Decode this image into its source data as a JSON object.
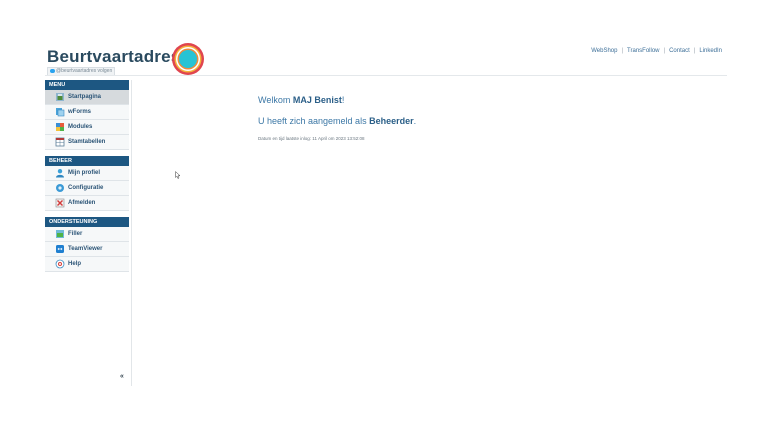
{
  "header": {
    "logo_text": "Beurtvaartadres",
    "twitter_follow": "@beurtvaartadres volgen",
    "links": [
      "WebShop",
      "TransFollow",
      "Contact",
      "LinkedIn"
    ]
  },
  "sidebar": {
    "sections": [
      {
        "title": "MENU",
        "items": [
          "Startpagina",
          "wForms",
          "Modules",
          "Stamtabellen"
        ]
      },
      {
        "title": "BEHEER",
        "items": [
          "Mijn profiel",
          "Configuratie",
          "Afmelden"
        ]
      },
      {
        "title": "ONDERSTEUNING",
        "items": [
          "Filler",
          "TeamViewer",
          "Help"
        ]
      }
    ],
    "active_item": "Startpagina",
    "collapse_label": "«"
  },
  "main": {
    "welcome_prefix": "Welkom ",
    "user_name": "MAJ Benist",
    "welcome_suffix": "!",
    "role_prefix": "U heeft zich aangemeld als ",
    "role_name": "Beheerder",
    "role_suffix": ".",
    "last_login": "Datum en tijd laatste inlog: 11 April om 2023 13:52:08"
  },
  "colors": {
    "brand_blue": "#1d5782",
    "link_blue": "#3d78a6",
    "logo_dark": "#2a4a5f",
    "target_red": "#e0454f",
    "target_cyan": "#27c3d4"
  }
}
